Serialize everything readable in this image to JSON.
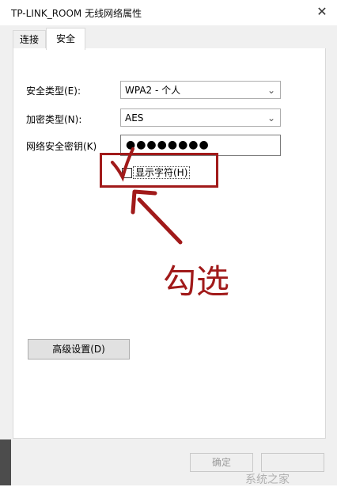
{
  "window": {
    "title": "TP-LINK_ROOM 无线网络属性"
  },
  "tabs": [
    {
      "label": "连接",
      "active": false
    },
    {
      "label": "安全",
      "active": true
    }
  ],
  "form": {
    "security_type_label": "安全类型(E):",
    "security_type_value": "WPA2 - 个人",
    "encryption_type_label": "加密类型(N):",
    "encryption_type_value": "AES",
    "key_label": "网络安全密钥(K)",
    "key_value": "●●●●●●●●",
    "show_chars_label": "显示字符(H)"
  },
  "buttons": {
    "advanced": "高级设置(D)",
    "ok": "确定"
  },
  "annotation": {
    "text": "勾选",
    "color": "#a11a1a"
  },
  "watermark": "系统之家"
}
